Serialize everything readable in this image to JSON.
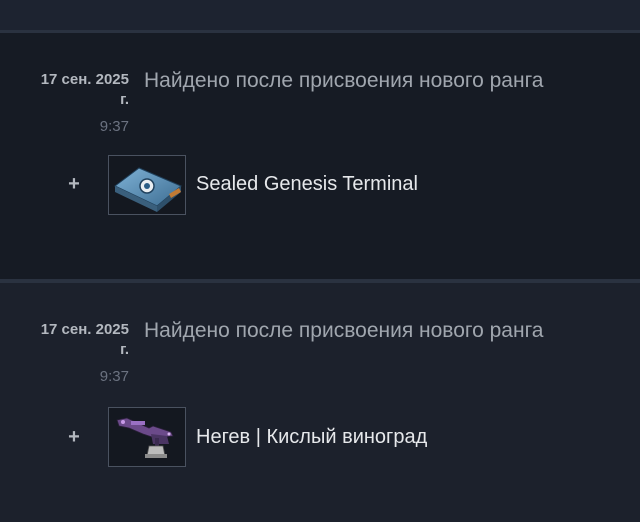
{
  "history": {
    "entries": [
      {
        "date_line1": "17 сен. 2025",
        "date_line2": "г.",
        "time": "9:37",
        "description": "Найдено после присвоения нового ранга",
        "item": {
          "sign": "+",
          "name": "Sealed Genesis Terminal",
          "icon": "terminal-case-icon"
        }
      },
      {
        "date_line1": "17 сен. 2025",
        "date_line2": "г.",
        "time": "9:37",
        "description": "Найдено после присвоения нового ранга",
        "item": {
          "sign": "+",
          "name": "Негев | Кислый виноград",
          "icon": "negev-rifle-icon"
        }
      }
    ]
  },
  "colors": {
    "background": "#1b202b",
    "entry_dark": "#161b24",
    "text_primary": "#e6e8eb",
    "text_secondary": "#a0a6ae",
    "text_muted": "#6b7280"
  }
}
